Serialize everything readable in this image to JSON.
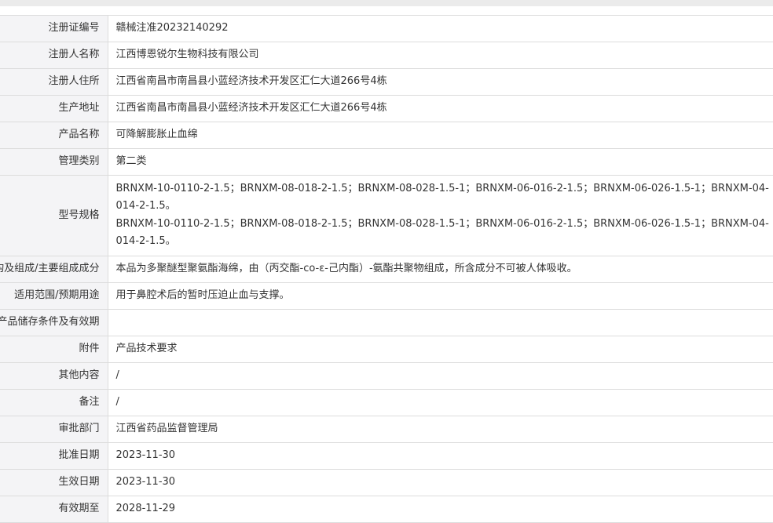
{
  "rows": [
    {
      "label": "注册证编号",
      "value": "赣械注准20232140292"
    },
    {
      "label": "注册人名称",
      "value": "江西博恩锐尔生物科技有限公司"
    },
    {
      "label": "注册人住所",
      "value": "江西省南昌市南昌县小蓝经济技术开发区汇仁大道266号4栋"
    },
    {
      "label": "生产地址",
      "value": "江西省南昌市南昌县小蓝经济技术开发区汇仁大道266号4栋"
    },
    {
      "label": "产品名称",
      "value": "可降解膨胀止血绵"
    },
    {
      "label": "管理类别",
      "value": "第二类"
    },
    {
      "label": "型号规格",
      "value_lines": [
        "BRNXM-10-0110-2-1.5；BRNXM-08-018-2-1.5；BRNXM-08-028-1.5-1；BRNXM-06-016-2-1.5；BRNXM-06-026-1.5-1；BRNXM-04-014-2-1.5。",
        "BRNXM-10-0110-2-1.5；BRNXM-08-018-2-1.5；BRNXM-08-028-1.5-1；BRNXM-06-016-2-1.5；BRNXM-06-026-1.5-1；BRNXM-04-014-2-1.5。"
      ]
    },
    {
      "label": "结构及组成/主要组成成分",
      "value": "本品为多聚醚型聚氨酯海绵，由（丙交酯-co-ε-己内酯）-氨酯共聚物组成，所含成分不可被人体吸收。"
    },
    {
      "label": "适用范围/预期用途",
      "value": "用于鼻腔术后的暂时压迫止血与支撑。"
    },
    {
      "label": "产品储存条件及有效期",
      "value": ""
    },
    {
      "label": "附件",
      "value": "产品技术要求"
    },
    {
      "label": "其他内容",
      "value": "/"
    },
    {
      "label": "备注",
      "value": "/"
    },
    {
      "label": "审批部门",
      "value": "江西省药品监督管理局"
    },
    {
      "label": "批准日期",
      "value": "2023-11-30"
    },
    {
      "label": "生效日期",
      "value": "2023-11-30"
    },
    {
      "label": "有效期至",
      "value": "2028-11-29"
    }
  ]
}
